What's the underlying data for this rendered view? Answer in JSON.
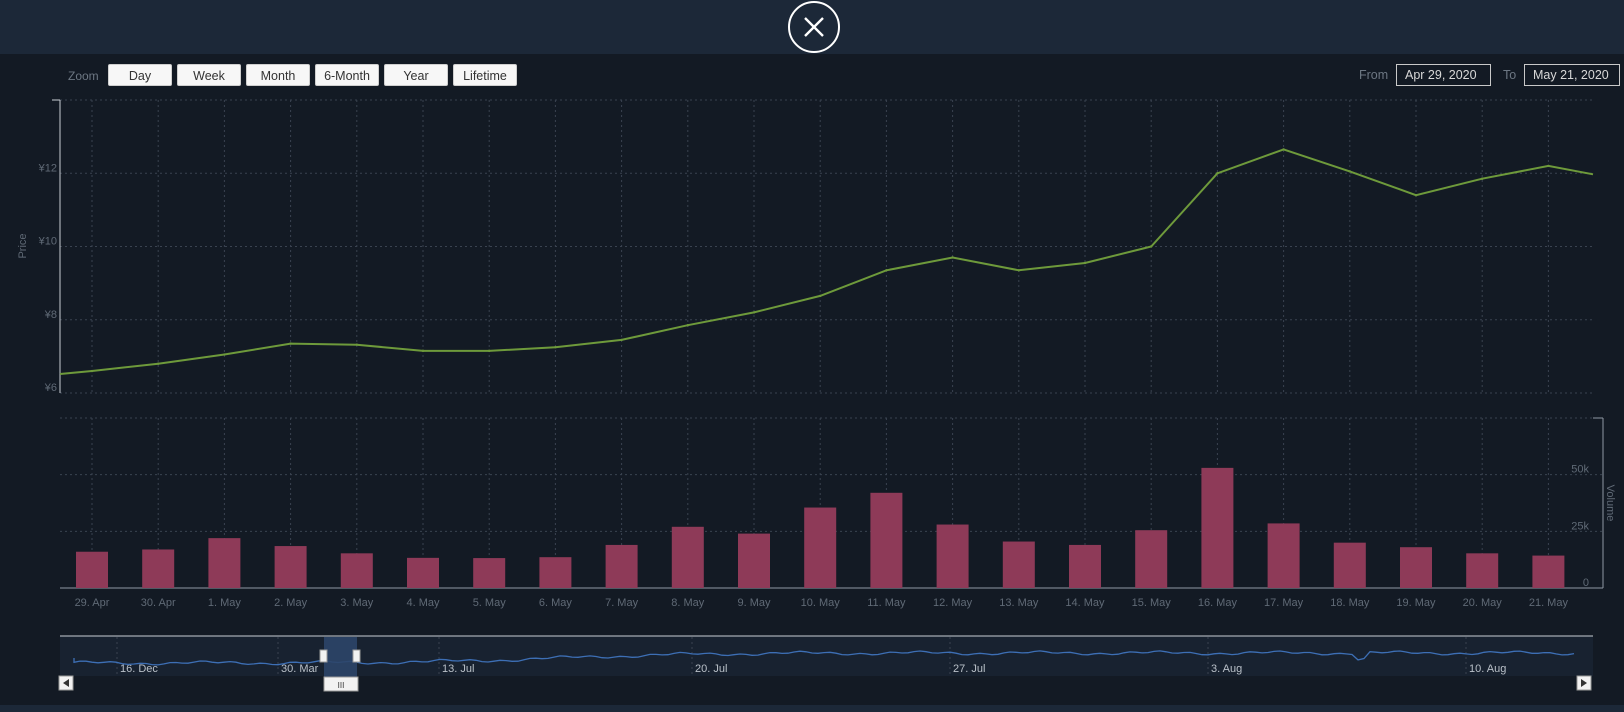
{
  "toolbar": {
    "zoom_label": "Zoom",
    "zoom_buttons": [
      "Day",
      "Week",
      "Month",
      "6-Month",
      "Year",
      "Lifetime"
    ],
    "from_label": "From",
    "from_value": "Apr 29, 2020",
    "to_label": "To",
    "to_value": "May 21, 2020"
  },
  "colors": {
    "price_line": "#6e9a3b",
    "volume_bar": "#8e3a58",
    "navigator_line": "#3d6fb5",
    "navigator_selection": "#2c4569"
  },
  "chart_data": [
    {
      "type": "line",
      "x": [
        "29. Apr",
        "30. Apr",
        "1. May",
        "2. May",
        "3. May",
        "4. May",
        "5. May",
        "6. May",
        "7. May",
        "8. May",
        "9. May",
        "10. May",
        "11. May",
        "12. May",
        "13. May",
        "14. May",
        "15. May",
        "16. May",
        "17. May",
        "18. May",
        "19. May",
        "20. May",
        "21. May"
      ],
      "series": [
        {
          "values": [
            6.6,
            6.8,
            7.05,
            7.35,
            7.32,
            7.15,
            7.15,
            7.25,
            7.45,
            7.85,
            8.2,
            8.65,
            9.35,
            9.7,
            9.35,
            9.55,
            10.0,
            12.0,
            12.65,
            12.05,
            11.4,
            11.85,
            12.2
          ]
        }
      ],
      "ylabel": "Price",
      "y_ticks": [
        "¥6",
        "¥8",
        "¥10",
        "¥12"
      ],
      "ylim": [
        6,
        14
      ],
      "grid": true
    },
    {
      "type": "bar",
      "categories": [
        "29. Apr",
        "30. Apr",
        "1. May",
        "2. May",
        "3. May",
        "4. May",
        "5. May",
        "6. May",
        "7. May",
        "8. May",
        "9. May",
        "10. May",
        "11. May",
        "12. May",
        "13. May",
        "14. May",
        "15. May",
        "16. May",
        "17. May",
        "18. May",
        "19. May",
        "20. May",
        "21. May"
      ],
      "series": [
        {
          "values": [
            16000,
            17000,
            22000,
            18500,
            15300,
            13300,
            13200,
            13600,
            19000,
            27000,
            24000,
            35500,
            42000,
            28000,
            20500,
            19000,
            25500,
            53000,
            28500,
            20000,
            18000,
            15300,
            14300
          ]
        }
      ],
      "ylabel": "Volume",
      "y_ticks": [
        "0",
        "25k",
        "50k"
      ],
      "ylim": [
        0,
        75000
      ],
      "grid": true
    }
  ],
  "navigator": {
    "labels": [
      "16. Dec",
      "30. Mar",
      "13. Jul",
      "20. Jul",
      "27. Jul",
      "3. Aug",
      "10. Aug"
    ],
    "handle_grip": "III"
  }
}
